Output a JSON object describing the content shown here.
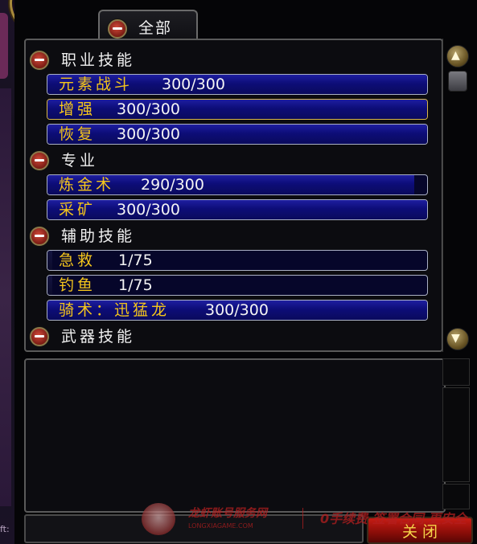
{
  "tab": {
    "label": "全部"
  },
  "categories": [
    {
      "label": "职业技能"
    },
    {
      "label": "专业"
    },
    {
      "label": "辅助技能"
    },
    {
      "label": "武器技能"
    }
  ],
  "skills": [
    {
      "name": "元素战斗",
      "value": "300/300",
      "fill": 1.0
    },
    {
      "name": "增强",
      "value": "300/300",
      "fill": 1.0
    },
    {
      "name": "恢复",
      "value": "300/300",
      "fill": 1.0
    },
    {
      "name": "炼金术",
      "value": "290/300",
      "fill": 0.967
    },
    {
      "name": "采矿",
      "value": "300/300",
      "fill": 1.0
    },
    {
      "name": "急救",
      "value": "1/75",
      "fill": 0.013
    },
    {
      "name": "钓鱼",
      "value": "1/75",
      "fill": 0.013
    },
    {
      "name": "骑术：迅猛龙",
      "value": "300/300",
      "fill": 1.0
    }
  ],
  "close_button": {
    "label": "关闭"
  },
  "side": {
    "text": "ft:"
  },
  "watermark": {
    "title": "龙虾账号服务网",
    "url": "LONGXIAGAME.COM",
    "slogan": "0手续费 签署合同 更安全"
  },
  "icons": {
    "scroll_up": "scroll-up-icon",
    "scroll_down": "scroll-down-icon",
    "collapse": "minus-icon"
  },
  "colors": {
    "skill_name": "#f4c51c",
    "bar_fill": "#1e1ea0",
    "close_button": "#c61c14",
    "highlight_border": "#d9b84a"
  }
}
